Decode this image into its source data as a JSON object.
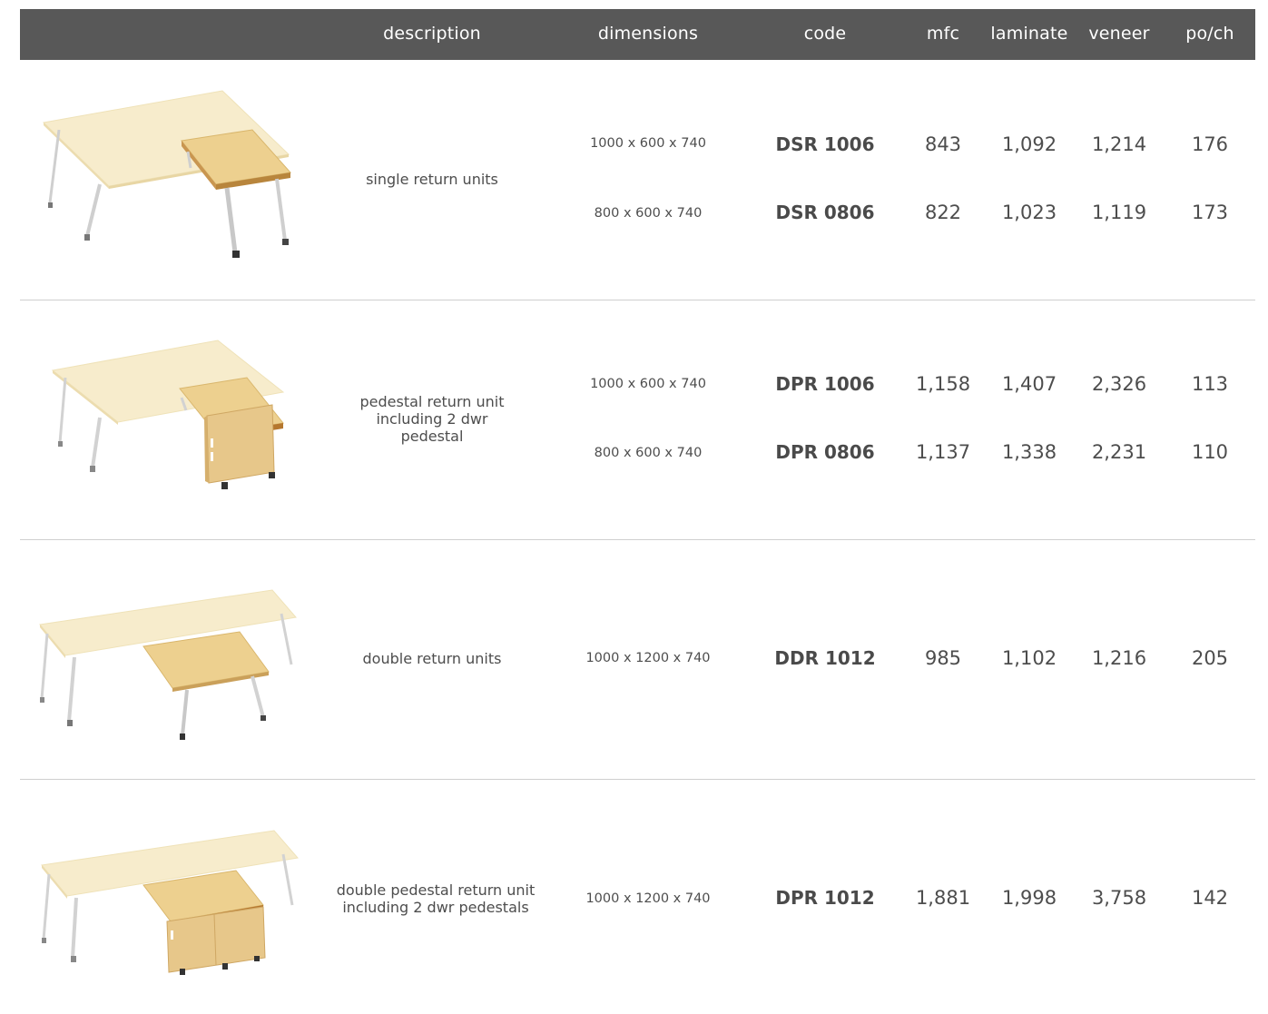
{
  "header": {
    "description": "description",
    "dimensions": "dimensions",
    "code": "code",
    "mfc": "mfc",
    "laminate": "laminate",
    "veneer": "veneer",
    "poch": "po/ch"
  },
  "rows": [
    {
      "description": "single return units",
      "image": "desk-single-return-image",
      "items": [
        {
          "dimensions": "1000 x 600 x 740",
          "code": "DSR 1006",
          "mfc": "843",
          "laminate": "1,092",
          "veneer": "1,214",
          "poch": "176"
        },
        {
          "dimensions": "800 x 600 x 740",
          "code": "DSR 0806",
          "mfc": "822",
          "laminate": "1,023",
          "veneer": "1,119",
          "poch": "173"
        }
      ]
    },
    {
      "description_lines": [
        "pedestal return unit",
        "including 2 dwr",
        "pedestal"
      ],
      "image": "desk-pedestal-return-image",
      "items": [
        {
          "dimensions": "1000 x 600 x 740",
          "code": "DPR 1006",
          "mfc": "1,158",
          "laminate": "1,407",
          "veneer": "2,326",
          "poch": "113"
        },
        {
          "dimensions": "800 x 600 x 740",
          "code": "DPR 0806",
          "mfc": "1,137",
          "laminate": "1,338",
          "veneer": "2,231",
          "poch": "110"
        }
      ]
    },
    {
      "description": "double return units",
      "image": "desk-double-return-image",
      "items": [
        {
          "dimensions": "1000 x 1200 x 740",
          "code": "DDR 1012",
          "mfc": "985",
          "laminate": "1,102",
          "veneer": "1,216",
          "poch": "205"
        }
      ]
    },
    {
      "description_lines": [
        "double pedestal return unit",
        "including 2 dwr pedestals"
      ],
      "image": "desk-double-pedestal-return-image",
      "items": [
        {
          "dimensions": "1000 x 1200 x 740",
          "code": "DPR 1012",
          "mfc": "1,881",
          "laminate": "1,998",
          "veneer": "3,758",
          "poch": "142"
        }
      ]
    }
  ],
  "colors": {
    "header_bg": "#585858",
    "header_text": "#ffffff",
    "wood_light": "#f3e6bf",
    "wood_dark": "#e6c98a",
    "edge_brown": "#b5772e",
    "divider": "#cfcfcf"
  }
}
